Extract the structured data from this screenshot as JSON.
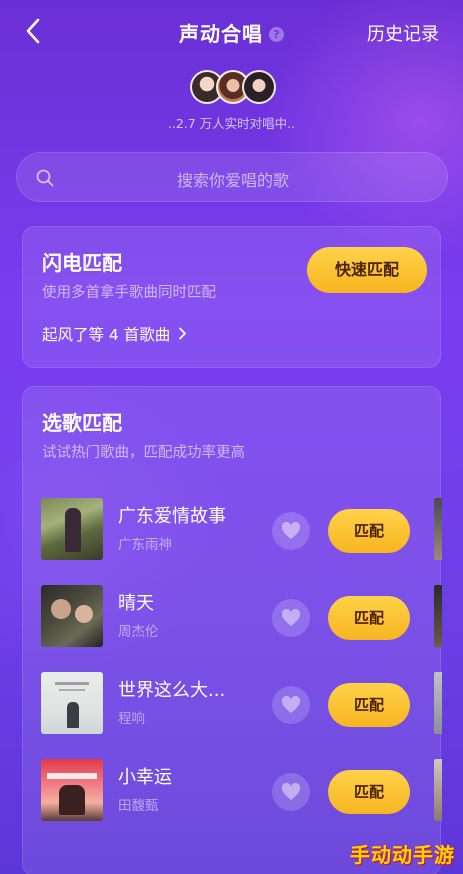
{
  "header": {
    "title": "声动合唱",
    "help_glyph": "?",
    "history_label": "历史记录"
  },
  "online_text": "..2.7 万人实时对唱中..",
  "search": {
    "placeholder": "搜索你爱唱的歌"
  },
  "lightning_match": {
    "title": "闪电匹配",
    "subtitle": "使用多首拿手歌曲同时匹配",
    "button_label": "快速匹配",
    "link_text": "起风了等 4 首歌曲"
  },
  "song_match": {
    "title": "选歌匹配",
    "subtitle": "试试热门歌曲，匹配成功率更高",
    "match_label": "匹配",
    "songs": [
      {
        "name": "广东爱情故事",
        "artist": "广东雨神"
      },
      {
        "name": "晴天",
        "artist": "周杰伦"
      },
      {
        "name": "世界这么大...",
        "artist": "程响"
      },
      {
        "name": "小幸运",
        "artist": "田馥甄"
      }
    ]
  },
  "watermark": "手动动手游",
  "colors": {
    "background_top": "#6a2fd4",
    "background_bottom": "#5d36d8",
    "accent_yellow": "#f7b520",
    "button_text": "#4a2200"
  },
  "icons": [
    "back-arrow-icon",
    "help-icon",
    "search-icon",
    "chevron-right-icon",
    "heart-icon"
  ]
}
